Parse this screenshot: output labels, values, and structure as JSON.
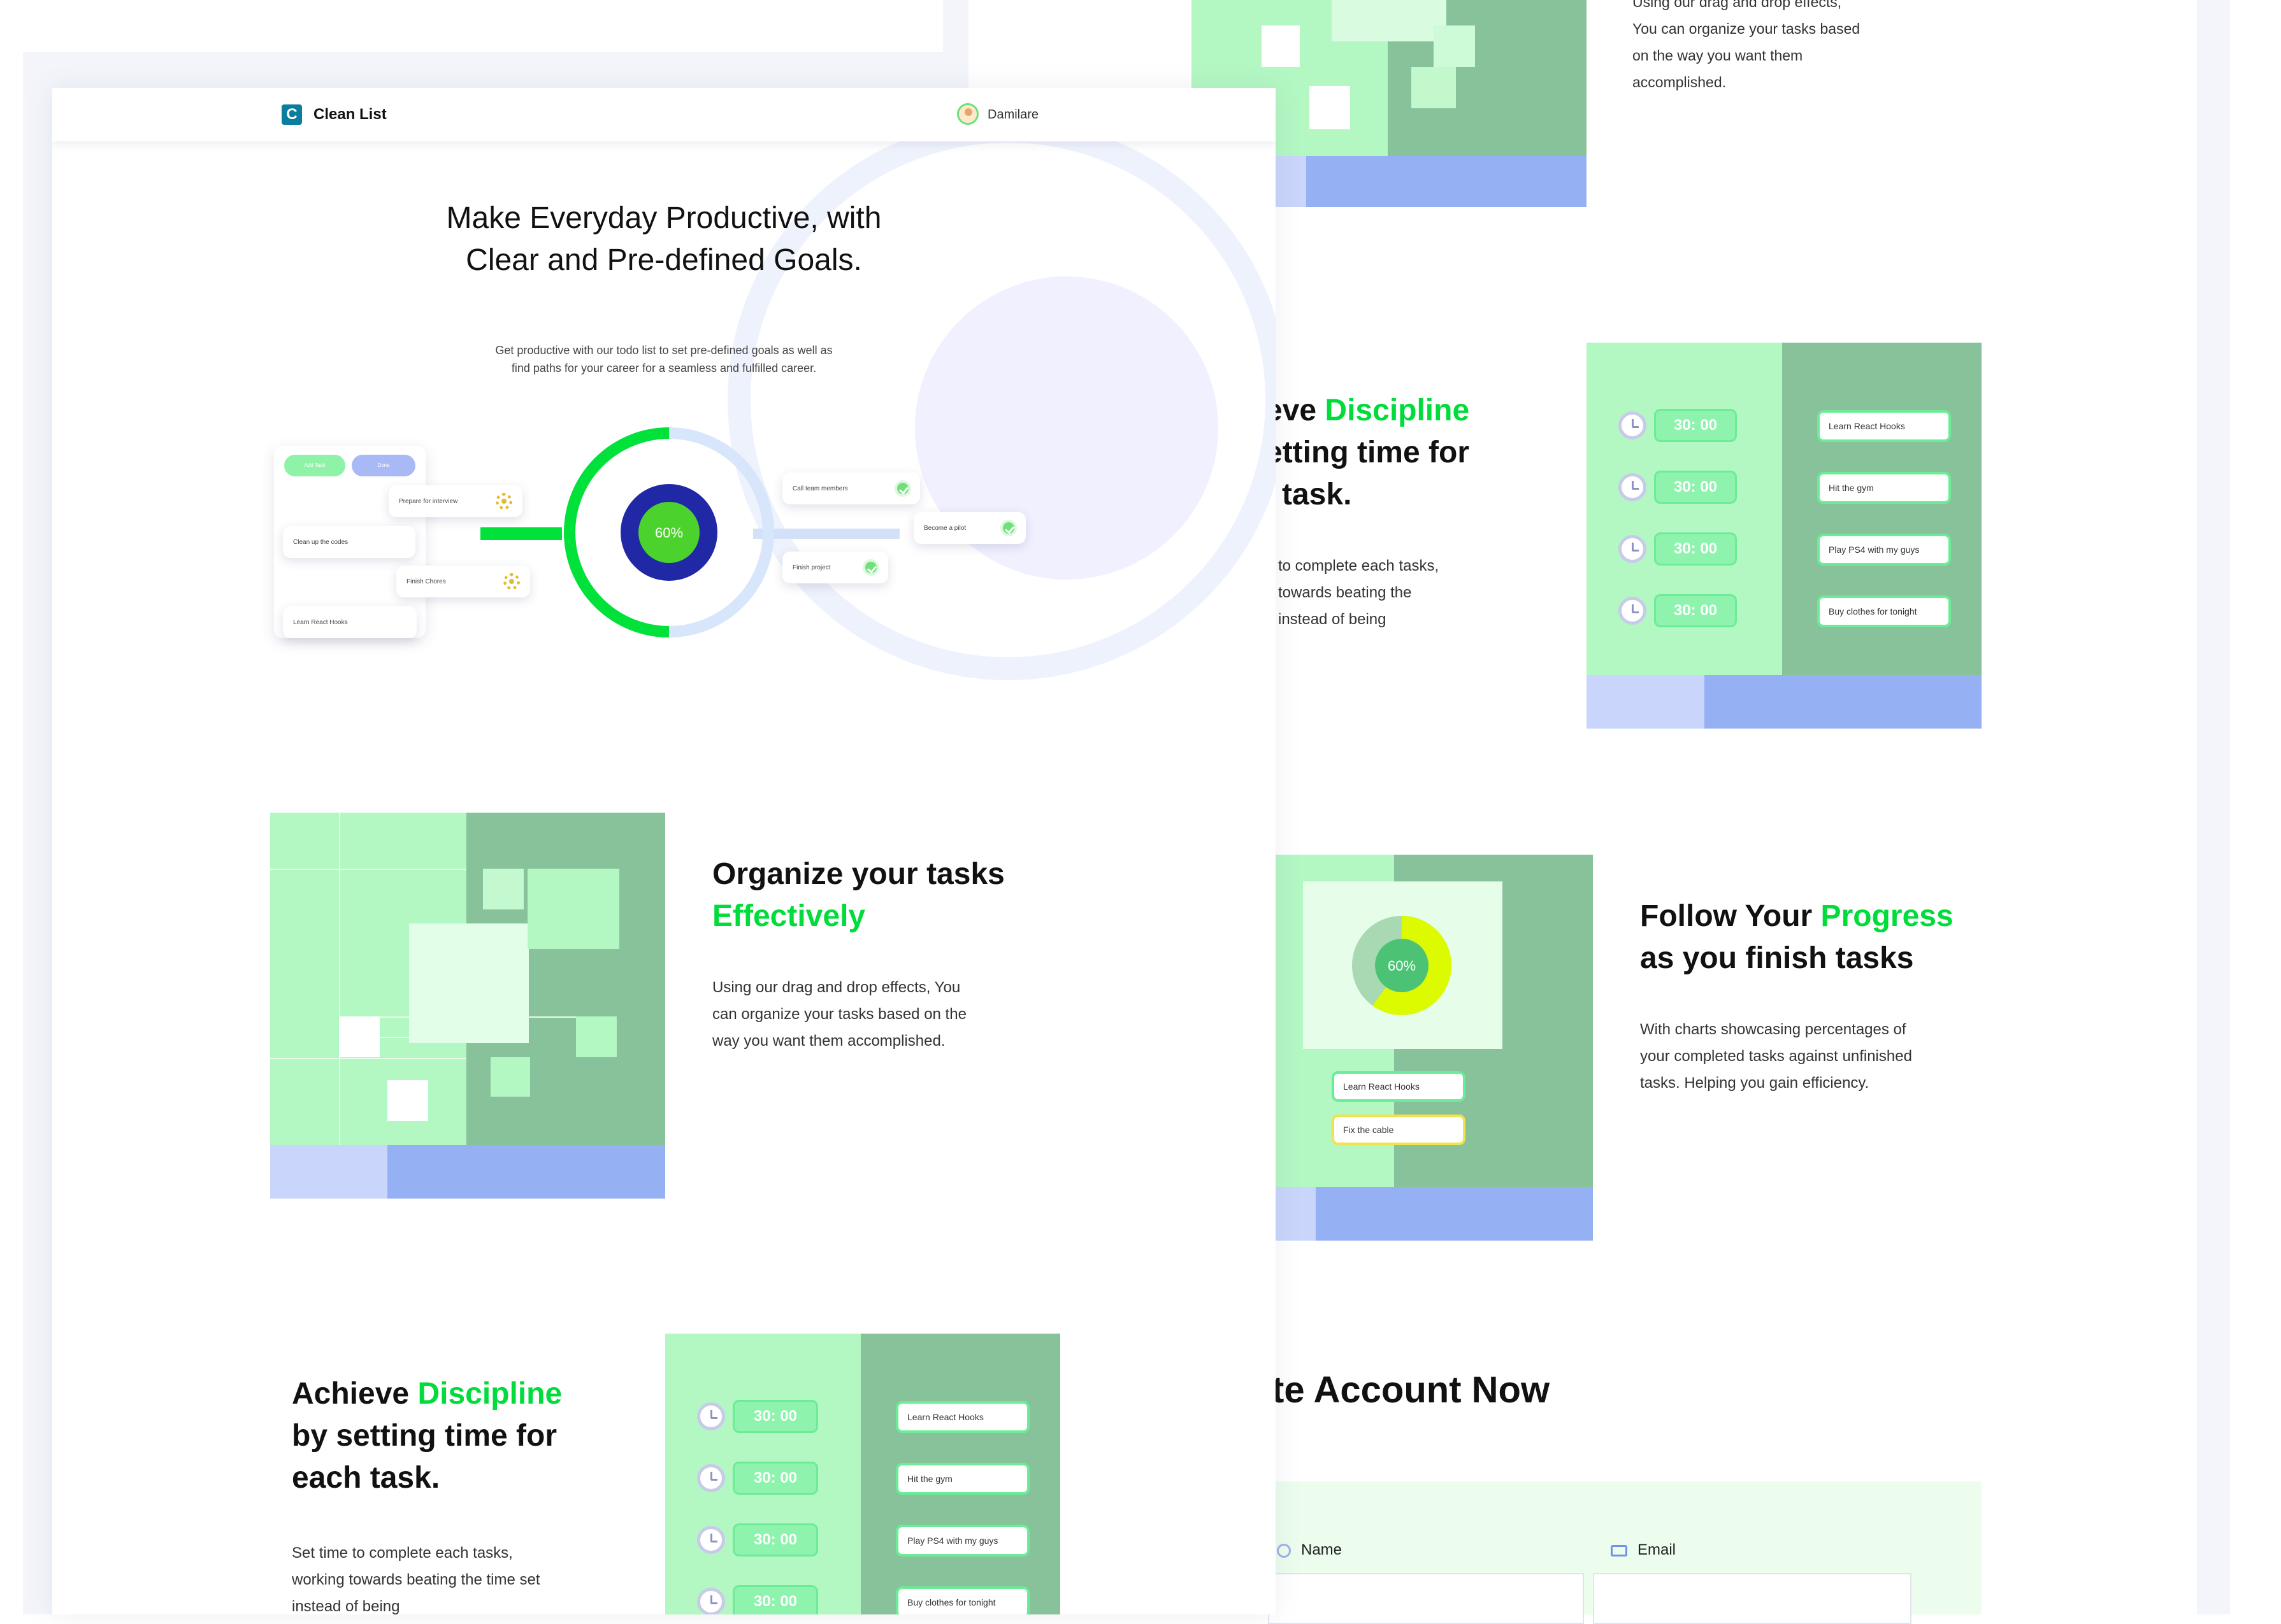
{
  "app": {
    "name": "Clean List",
    "logo_letter": "C"
  },
  "user": {
    "name": "Damilare"
  },
  "hero": {
    "title": "Make Everyday Productive, with Clear and Pre-defined Goals.",
    "subtitle": "Get productive with our todo list to set pre-defined goals as well as find paths for your career for a seamless and fulfilled career.",
    "progress_label": "60%",
    "progress_value": 0.6,
    "buttons": {
      "add": "Add Task",
      "done": "Done"
    },
    "left_tasks": [
      "Prepare for interview",
      "Clean up the codes",
      "Finish Chores",
      "Learn React Hooks"
    ],
    "right_tasks": [
      "Call team members",
      "Become a pilot",
      "Finish project"
    ]
  },
  "organize": {
    "title_plain": "Organize your tasks",
    "title_accent": "Effectively",
    "body": "Using our drag and drop effects, You can organize your tasks based on the way you want them accomplished.",
    "body_top_fragment": "Using our drag and drop effects,"
  },
  "discipline": {
    "title_plain_1": "Achieve ",
    "title_accent": "Discipline",
    "title_plain_2": "by setting time for each task.",
    "body": "Set time to complete each tasks, working towards beating the time set instead of being",
    "cropped_title_1": "eve ",
    "cropped_title_2": "etting time for",
    "cropped_title_3": "task.",
    "cropped_body": [
      "to complete each tasks,",
      "towards beating the",
      "instead of being"
    ],
    "timer_label": "30: 00",
    "tasks": [
      "Learn React Hooks",
      "Hit the gym",
      "Play PS4 with my guys",
      "Buy clothes for tonight"
    ]
  },
  "progress": {
    "title_plain_1": "Follow Your ",
    "title_accent": "Progress",
    "title_plain_2": "as you finish tasks",
    "body": "With charts showcasing percentages of your completed tasks against unfinished tasks. Helping you gain efficiency.",
    "chart_label": "60%",
    "chart_value": 0.6,
    "tasks": [
      "Learn React Hooks",
      "Fix the cable"
    ]
  },
  "signup": {
    "title_fragment": "te Account Now",
    "name_label": "Name",
    "email_label": "Email"
  },
  "colors": {
    "accent": "#00dc3a",
    "panel_light": "#b3f7c3",
    "panel_dark": "#88c29a",
    "panel_blue": "#96b0f4",
    "panel_blue_light": "#c9d5fb",
    "navy": "#1f2aa3"
  }
}
